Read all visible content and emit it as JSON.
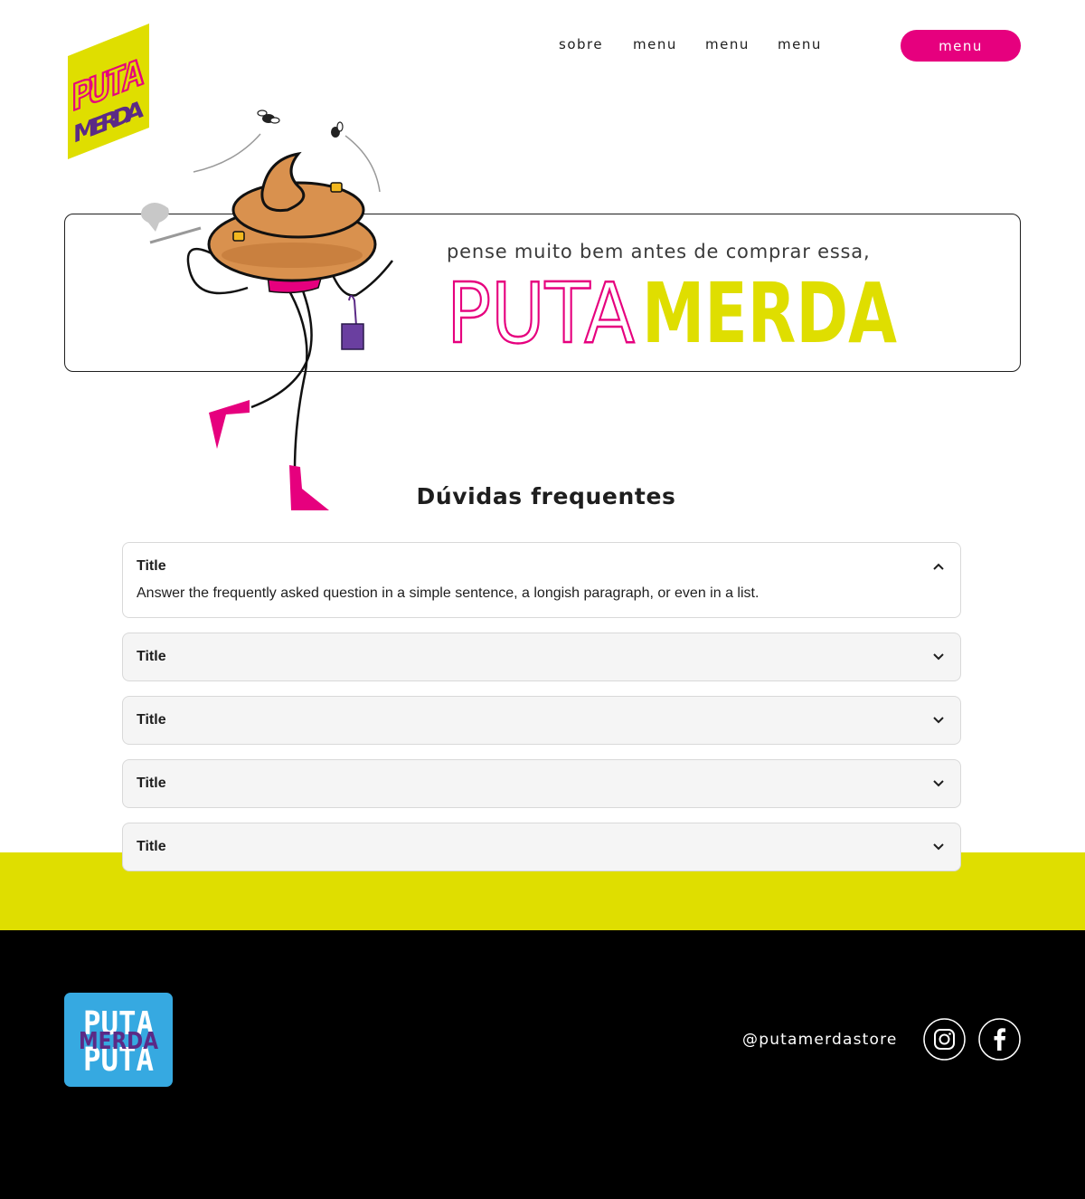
{
  "brand": {
    "logo_line1": "PUTA",
    "logo_line2": "MERDA",
    "colors": {
      "pink": "#e6007e",
      "yellow": "#dfde00",
      "purple": "#5b2a86",
      "blue": "#36a9e1",
      "black": "#000000"
    }
  },
  "nav": {
    "links": [
      "sobre",
      "menu",
      "menu",
      "menu"
    ],
    "cta_label": "menu"
  },
  "hero": {
    "tagline": "pense muito bem antes de comprar essa,",
    "wordmark_outline": "PUTA",
    "wordmark_solid": "MERDA"
  },
  "faq": {
    "heading": "Dúvidas frequentes",
    "items": [
      {
        "title": "Title",
        "answer": "Answer the frequently asked question in a simple sentence, a longish paragraph, or even in a list.",
        "expanded": true,
        "icon": "chevron-up-icon"
      },
      {
        "title": "Title",
        "expanded": false,
        "icon": "chevron-down-icon"
      },
      {
        "title": "Title",
        "expanded": false,
        "icon": "chevron-down-icon"
      },
      {
        "title": "Title",
        "expanded": false,
        "icon": "chevron-down-icon"
      },
      {
        "title": "Title",
        "expanded": false,
        "icon": "chevron-down-icon"
      }
    ]
  },
  "footer": {
    "handle": "@putamerdastore",
    "social": [
      "instagram-icon",
      "facebook-icon"
    ]
  }
}
